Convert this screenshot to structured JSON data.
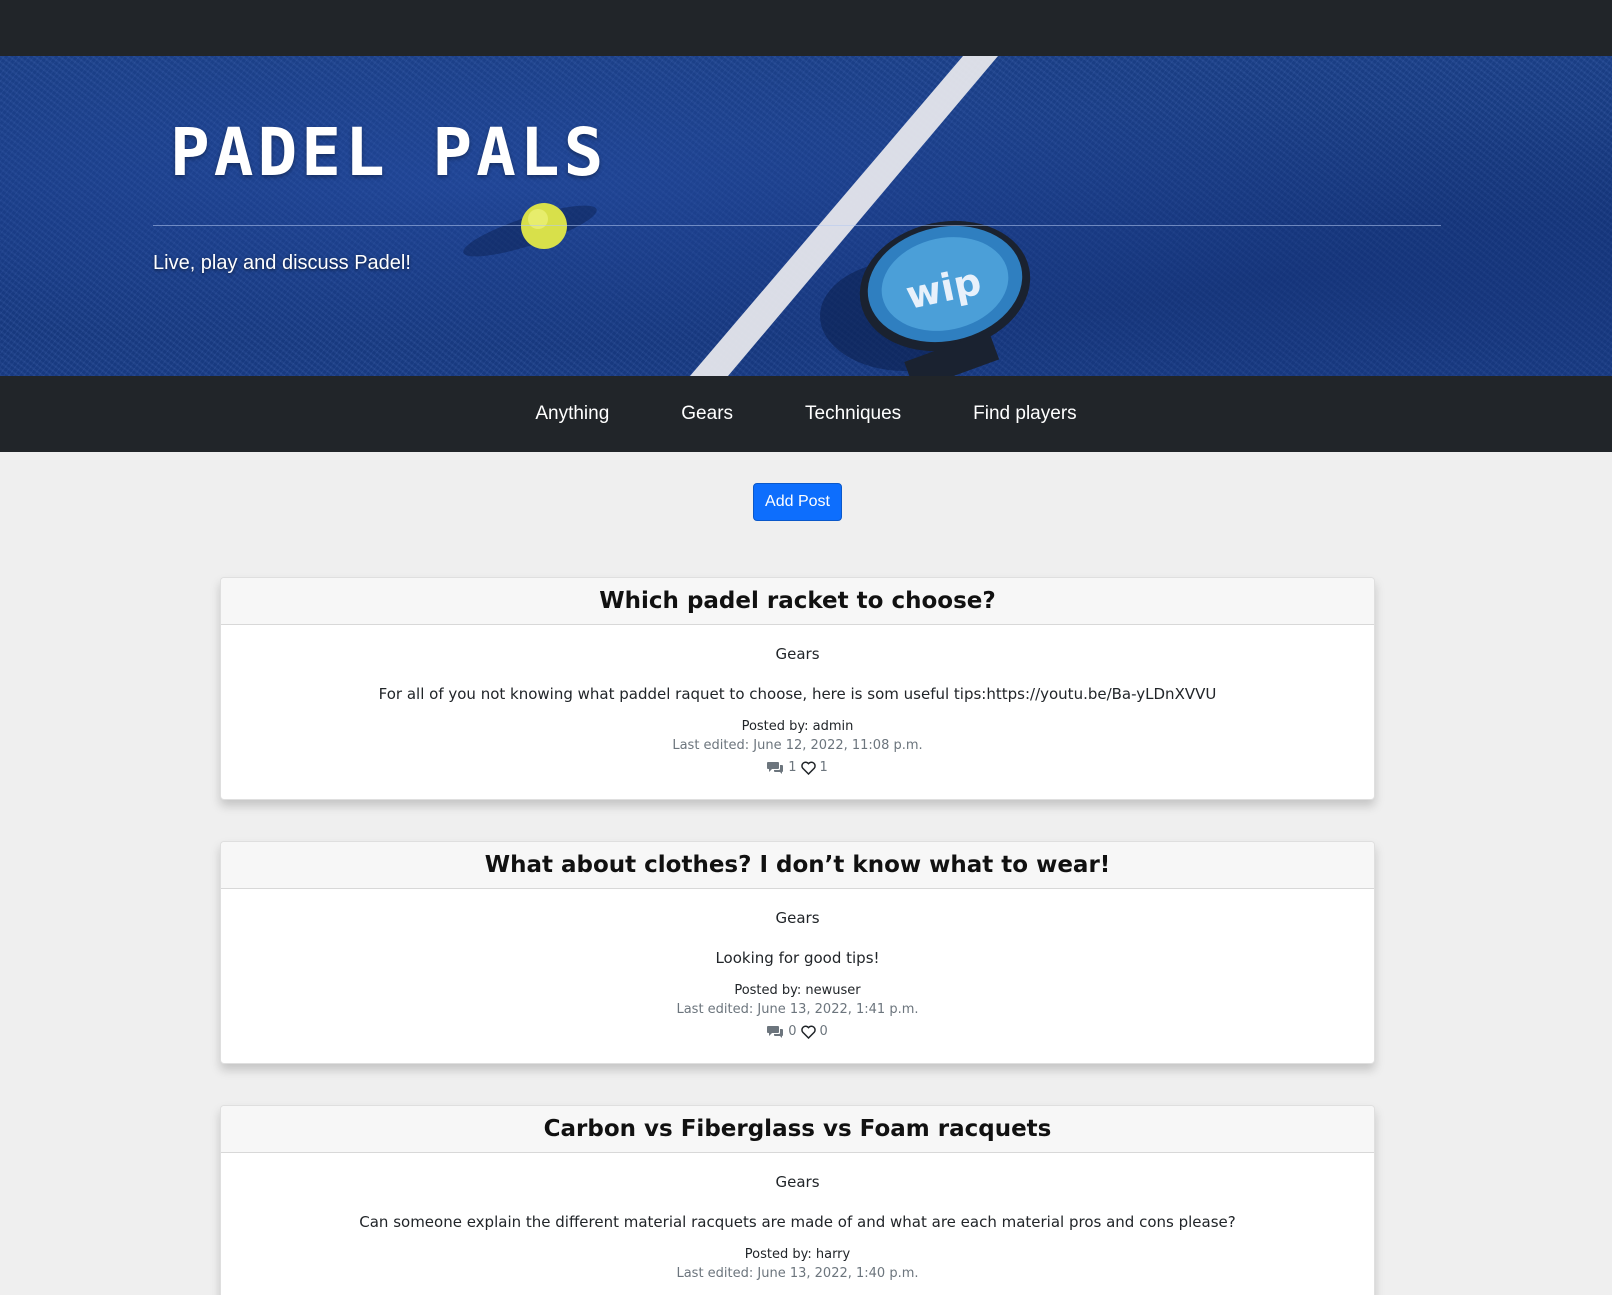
{
  "site": {
    "title": "PADEL PALS",
    "tagline": "Live, play and discuss Padel!"
  },
  "nav": {
    "items": [
      {
        "label": "Anything"
      },
      {
        "label": "Gears"
      },
      {
        "label": "Techniques"
      },
      {
        "label": "Find players"
      }
    ]
  },
  "actions": {
    "add_post_label": "Add Post",
    "add_post_color": "#0d6efd"
  },
  "posts": [
    {
      "title": "Which padel racket to choose?",
      "category": "Gears",
      "content": "For all of you not knowing what paddel raquet to choose, here is som useful tips:https://youtu.be/Ba-yLDnXVVU",
      "author": "Posted by: admin",
      "edited": "Last edited: June 12, 2022, 11:08 p.m.",
      "comments": "1",
      "likes": "1"
    },
    {
      "title": "What about clothes? I don’t know what to wear!",
      "category": "Gears",
      "content": "Looking for good tips!",
      "author": "Posted by: newuser",
      "edited": "Last edited: June 13, 2022, 1:41 p.m.",
      "comments": "0",
      "likes": "0"
    },
    {
      "title": "Carbon vs Fiberglass vs Foam racquets",
      "category": "Gears",
      "content": "Can someone explain the different material racquets are made of and what are each material pros and cons please?",
      "author": "Posted by: harry",
      "edited": "Last edited: June 13, 2022, 1:40 p.m.",
      "comments": "",
      "likes": ""
    }
  ],
  "icons": {
    "comments": "comments-icon",
    "likes": "heart-icon",
    "hero": "padel-court-image"
  }
}
